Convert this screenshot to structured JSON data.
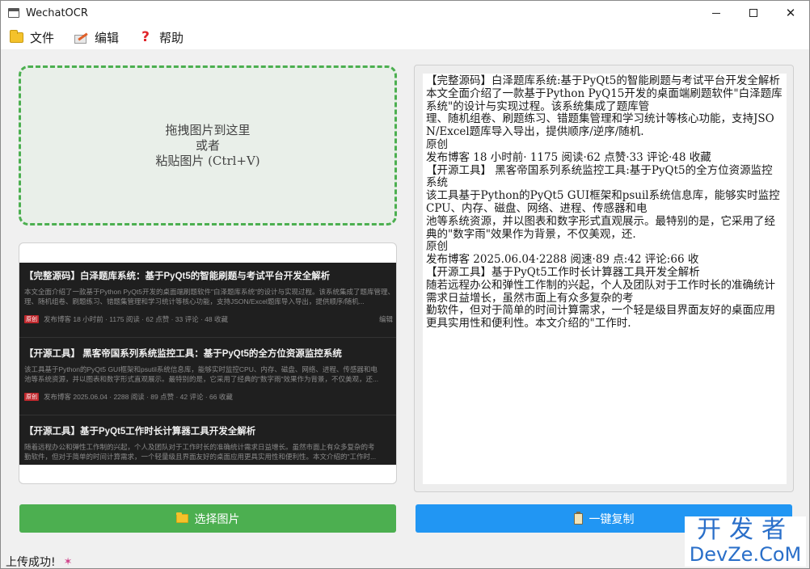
{
  "window": {
    "title": "WechatOCR"
  },
  "menu": {
    "file": "文件",
    "edit": "编辑",
    "help": "帮助"
  },
  "drop_zone": {
    "line1": "拖拽图片到这里",
    "line2": "或者",
    "line3": "粘贴图片 (Ctrl+V)"
  },
  "preview": {
    "posts": [
      {
        "title": "【完整源码】白泽题库系统：基于PyQt5的智能刷题与考试平台开发全解析",
        "desc1": "本文全面介绍了一款基于Python PyQt5开发的桌面端刷题软件\"白泽题库系统\"的设计与实现过程。该系统集成了题库管理、",
        "desc2": "理、随机组卷、刷题练习、错题集管理和学习统计等核心功能，支持JSON/Excel题库导入导出，提供顺序/随机...",
        "tag": "原创",
        "meta": "发布博客 18 小时前 · 1175 阅读 · 62 点赞 · 33 评论 · 48 收藏",
        "extra": "编辑"
      },
      {
        "title": "【开源工具】 黑客帝国系列系统监控工具：基于PyQt5的全方位资源监控系统",
        "desc1": "该工具基于Python的PyQt5 GUI框架和psutil系统信息库，能够实时监控CPU、内存、磁盘、网络、进程、传感器和电",
        "desc2": "池等系统资源，并以图表和数字形式直观展示。最特别的是，它采用了经典的\"数字雨\"效果作为背景，不仅美观，还...",
        "tag": "原创",
        "meta": "发布博客 2025.06.04 · 2288 阅读 · 89 点赞 · 42 评论 · 66 收藏",
        "extra": ""
      },
      {
        "title": "【开源工具】基于PyQt5工作时长计算器工具开发全解析",
        "desc1": "随着远程办公和弹性工作制的兴起，个人及团队对于工作时长的准确统计需求日益增长。虽然市面上有众多复杂的考",
        "desc2": "勤软件，但对于简单的时间计算需求，一个轻量级且界面友好的桌面应用更具实用性和便利性。本文介绍的\"工作时...",
        "tag": "",
        "meta": "",
        "extra": ""
      }
    ]
  },
  "result": {
    "text": "【完整源码】白泽题库系统:基于PyQt5的智能刷题与考试平台开发全解析\n本文全面介绍了一款基于Python PyQ15开发的桌面端刷题软件\"白泽题库系统\"的设计与实现过程。该系统集成了题库管\n理、随机组卷、刷题练习、错题集管理和学习统计等核心功能，支持JSON/Excel题库导入导出，提供顺序/逆序/随机.\n原创\n发布博客 18 小时前· 1175 阅读·62 点赞·33 评论·48 收藏\n【开源工具】 黑客帝国系列系统监控工具:基于PyQt5的全方位资源监控系统\n该工具基于Python的PyQt5 GUI框架和psuil系统信息库，能够实时监控CPU、内存、磁盘、网络、进程、传感器和电\n池等系统资源，并以图表和数字形式直观展示。最特别的是，它采用了经典的\"数字雨\"效果作为背景，不仅美观，还.\n原创\n发布博客 2025.06.04·2288 阅速·89 点:42 评论:66 收\n【开源工具】基于PyQt5工作时长计算器工具开发全解析\n随若远程办公和弹性工作制的兴起，个人及团队对于工作时长的准确统计需求日益增长，虽然市面上有众多复杂的考\n勤软件，但对于简单的时间计算需求，一个轻是级目界面友好的桌面应用更具实用性和便利性。本文介绍的\"工作时."
  },
  "buttons": {
    "select": "选择图片",
    "copy": "一键复制"
  },
  "status": {
    "text": "上传成功!"
  },
  "watermark": {
    "top": "开发者",
    "bottom": "DevZe.CoM"
  },
  "colors": {
    "accent_green": "#4caf50",
    "accent_blue": "#2196f3"
  }
}
